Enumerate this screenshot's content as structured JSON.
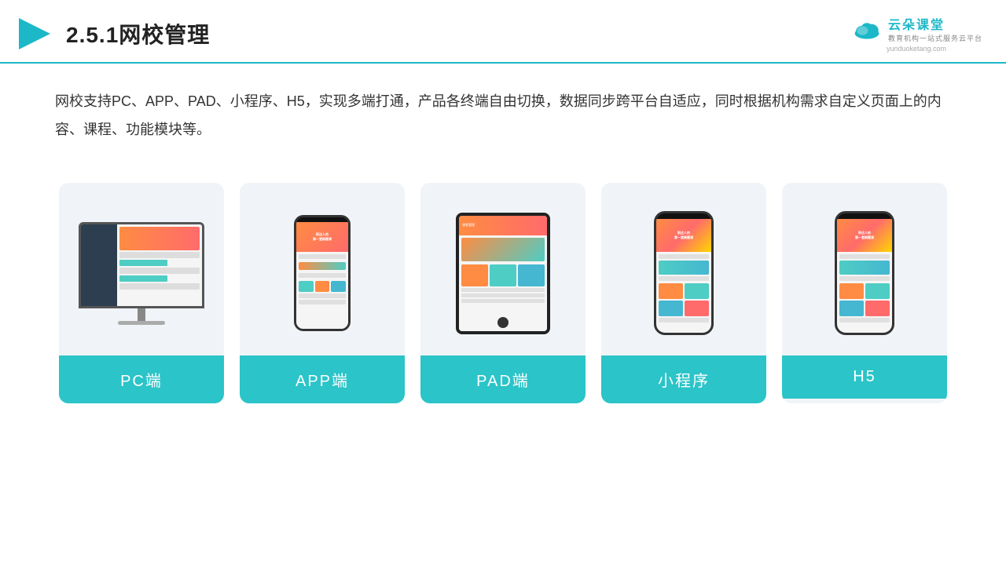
{
  "header": {
    "title": "2.5.1网校管理",
    "brand": {
      "name": "云朵课堂",
      "tagline": "教育机构一站式服务云平台",
      "url": "yunduoketang.com"
    }
  },
  "description": "网校支持PC、APP、PAD、小程序、H5，实现多端打通，产品各终端自由切换，数据同步跨平台自适应，同时根据机构需求自定义页面上的内容、课程、功能模块等。",
  "cards": [
    {
      "id": "pc",
      "label": "PC端"
    },
    {
      "id": "app",
      "label": "APP端"
    },
    {
      "id": "pad",
      "label": "PAD端"
    },
    {
      "id": "miniprogram",
      "label": "小程序"
    },
    {
      "id": "h5",
      "label": "H5"
    }
  ],
  "accent_color": "#2bc4c8"
}
